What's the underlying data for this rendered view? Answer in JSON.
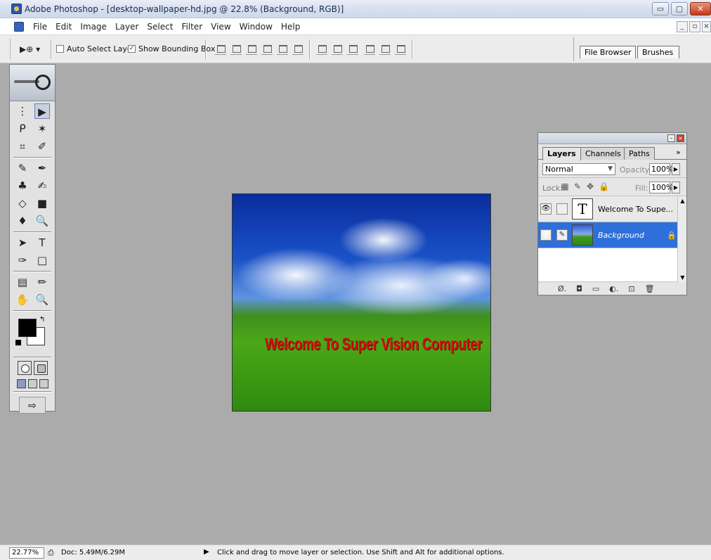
{
  "window": {
    "title": "Adobe Photoshop - [desktop-wallpaper-hd.jpg @ 22.8% (Background, RGB)]",
    "minimize": "▭",
    "maximize": "▢",
    "close": "✕"
  },
  "menubar": {
    "items": [
      "File",
      "Edit",
      "Image",
      "Layer",
      "Select",
      "Filter",
      "View",
      "Window",
      "Help"
    ],
    "doc_min": "_",
    "doc_restore": "▫",
    "doc_close": "×"
  },
  "options": {
    "tool_preset": "▶⊕ ▾",
    "auto_select_label": "Auto Select Layer",
    "auto_select_checked": false,
    "show_bounding_label": "Show Bounding Box",
    "show_bounding_checked": true,
    "check_mark": "✓",
    "palette_well_tabs": [
      "File Browser",
      "Brushes"
    ]
  },
  "toolbox": {
    "tools": [
      [
        "⋮",
        "▶"
      ],
      [
        "ᑭ",
        "✶"
      ],
      [
        "⌗",
        "✐"
      ],
      [
        "✎",
        "✒"
      ],
      [
        "♣",
        "✍"
      ],
      [
        "◇",
        "■"
      ],
      [
        "♦",
        "🔍"
      ],
      [
        "➤",
        "T"
      ],
      [
        "✑",
        "□"
      ],
      [
        "▤",
        "✏"
      ],
      [
        "✋",
        "🔍"
      ]
    ],
    "swap_colors": "↰",
    "imageready": "⇨"
  },
  "document": {
    "welcome_text": "Welcome To Super Vision Computer"
  },
  "layers_palette": {
    "tabs": [
      "Layers",
      "Channels",
      "Paths"
    ],
    "more": "»",
    "blend_mode": "Normal",
    "opacity_label": "Opacity:",
    "opacity_value": "100%",
    "lock_label": "Lock:",
    "fill_label": "Fill:",
    "fill_value": "100%",
    "layers": [
      {
        "name": "Welcome To Supe...",
        "thumb": "T",
        "selected": false
      },
      {
        "name": "Background",
        "selected": true
      }
    ],
    "footer_icons": [
      "Ø.",
      "◘",
      "▭",
      "◐.",
      "⊡",
      "🗑"
    ]
  },
  "status": {
    "zoom": "22.77%",
    "doc_size": "Doc: 5.49M/6.29M",
    "hint": "Click and drag to move layer or selection.  Use Shift and Alt for additional options."
  }
}
